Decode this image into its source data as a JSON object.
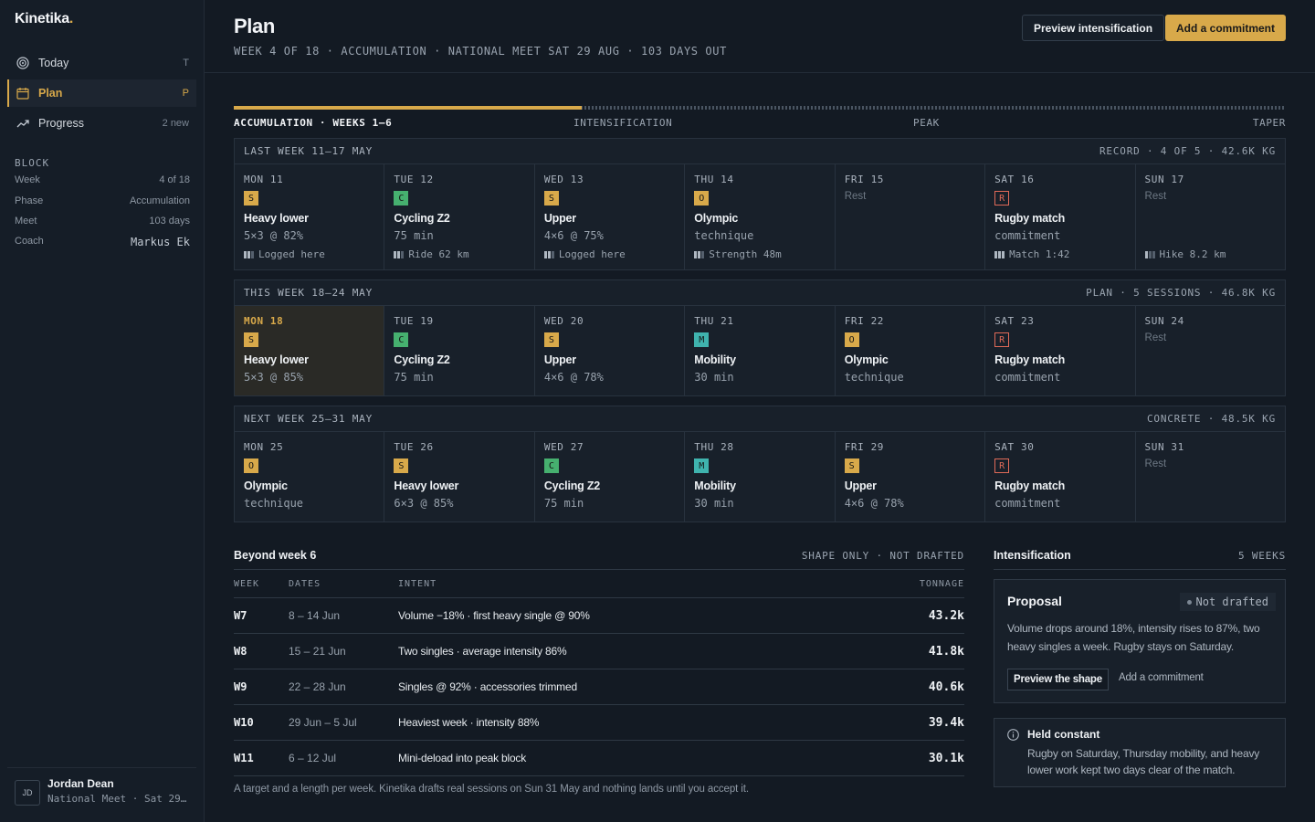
{
  "app": {
    "brand": "Kinetika",
    "brand_dot": "."
  },
  "nav": [
    {
      "label": "Today",
      "key": "T"
    },
    {
      "label": "Plan",
      "key": "P"
    },
    {
      "label": "Progress",
      "key": "2 new"
    }
  ],
  "block": {
    "title": "BLOCK",
    "rows": [
      {
        "k": "Week",
        "v": "4 of 18"
      },
      {
        "k": "Phase",
        "v": "Accumulation"
      },
      {
        "k": "Meet",
        "v": "103 days"
      },
      {
        "k": "Coach",
        "v": "Markus Ek"
      }
    ]
  },
  "user": {
    "initials": "JD",
    "name": "Jordan Dean",
    "subtitle": "National Meet · Sat 29 Aug"
  },
  "header": {
    "title": "Plan",
    "subtitle": "WEEK 4 OF 18 · ACCUMULATION · NATIONAL MEET SAT 29 AUG · 103 DAYS OUT",
    "preview_label": "Preview intensification",
    "add_label": "Add a commitment"
  },
  "phases": {
    "progress": 0.331,
    "labels": [
      "ACCUMULATION · WEEKS 1–6",
      "INTENSIFICATION",
      "PEAK",
      "TAPER"
    ]
  },
  "weeks": [
    {
      "label": "LAST WEEK  11–17 MAY",
      "meta": "RECORD · 4 OF 5 · 42.6K KG",
      "days": [
        {
          "label": "MON 11",
          "type": "S",
          "title": "Heavy lower",
          "detail": "5×3 @ 82%",
          "log": "Logged here",
          "bars": 2
        },
        {
          "label": "TUE 12",
          "type": "C",
          "title": "Cycling Z2",
          "detail": "75 min",
          "log": "Ride 62 km",
          "bars": 2
        },
        {
          "label": "WED 13",
          "type": "S",
          "title": "Upper",
          "detail": "4×6 @ 75%",
          "log": "Logged here",
          "bars": 2
        },
        {
          "label": "THU 14",
          "type": "O",
          "title": "Olympic",
          "detail": "technique",
          "log": "Strength 48m",
          "bars": 2
        },
        {
          "label": "FRI 15",
          "rest": "Rest"
        },
        {
          "label": "SAT 16",
          "type": "R",
          "title": "Rugby match",
          "detail": "commitment",
          "log": "Match 1:42",
          "bars": 3
        },
        {
          "label": "SUN 17",
          "rest": "Rest",
          "log": "Hike 8.2 km",
          "bars": 1
        }
      ]
    },
    {
      "label": "THIS WEEK  18–24 MAY",
      "meta": "PLAN · 5 SESSIONS · 46.8K KG",
      "days": [
        {
          "label": "MON 18",
          "type": "S",
          "title": "Heavy lower",
          "detail": "5×3 @ 85%",
          "today": true
        },
        {
          "label": "TUE 19",
          "type": "C",
          "title": "Cycling Z2",
          "detail": "75 min"
        },
        {
          "label": "WED 20",
          "type": "S",
          "title": "Upper",
          "detail": "4×6 @ 78%"
        },
        {
          "label": "THU 21",
          "type": "M",
          "title": "Mobility",
          "detail": "30 min"
        },
        {
          "label": "FRI 22",
          "type": "O",
          "title": "Olympic",
          "detail": "technique"
        },
        {
          "label": "SAT 23",
          "type": "R",
          "title": "Rugby match",
          "detail": "commitment"
        },
        {
          "label": "SUN 24",
          "rest": "Rest"
        }
      ]
    },
    {
      "label": "NEXT WEEK  25–31 MAY",
      "meta": "CONCRETE · 48.5K KG",
      "days": [
        {
          "label": "MON 25",
          "type": "O",
          "title": "Olympic",
          "detail": "technique"
        },
        {
          "label": "TUE 26",
          "type": "S",
          "title": "Heavy lower",
          "detail": "6×3 @ 85%"
        },
        {
          "label": "WED 27",
          "type": "C",
          "title": "Cycling Z2",
          "detail": "75 min"
        },
        {
          "label": "THU 28",
          "type": "M",
          "title": "Mobility",
          "detail": "30 min"
        },
        {
          "label": "FRI 29",
          "type": "S",
          "title": "Upper",
          "detail": "4×6 @ 78%"
        },
        {
          "label": "SAT 30",
          "type": "R",
          "title": "Rugby match",
          "detail": "commitment"
        },
        {
          "label": "SUN 31",
          "rest": "Rest"
        }
      ]
    }
  ],
  "beyond": {
    "title": "Beyond week 6",
    "tag": "SHAPE ONLY · NOT DRAFTED",
    "columns": {
      "week": "WEEK",
      "dates": "DATES",
      "intent": "INTENT",
      "tonnage": "TONNAGE"
    },
    "rows": [
      {
        "week": "W7",
        "dates": "8 – 14 Jun",
        "intent": "Volume −18% · first heavy single @ 90%",
        "tonnage": "43.2k"
      },
      {
        "week": "W8",
        "dates": "15 – 21 Jun",
        "intent": "Two singles · average intensity 86%",
        "tonnage": "41.8k"
      },
      {
        "week": "W9",
        "dates": "22 – 28 Jun",
        "intent": "Singles @ 92% · accessories trimmed",
        "tonnage": "40.6k"
      },
      {
        "week": "W10",
        "dates": "29 Jun – 5 Jul",
        "intent": "Heaviest week · intensity 88%",
        "tonnage": "39.4k"
      },
      {
        "week": "W11",
        "dates": "6 – 12 Jul",
        "intent": "Mini-deload into peak block",
        "tonnage": "30.1k"
      }
    ],
    "footnote": "A target and a length per week. Kinetika drafts real sessions on Sun 31 May and nothing lands until you accept it."
  },
  "intensification": {
    "title": "Intensification",
    "weeks": "5 WEEKS",
    "proposal": {
      "title": "Proposal",
      "state": "Not drafted",
      "body": "Volume drops around 18%, intensity rises to 87%, two heavy singles a week. Rugby stays on Saturday.",
      "preview": "Preview the shape",
      "add": "Add a commitment"
    },
    "held": {
      "title": "Held constant",
      "body": "Rugby on Saturday, Thursday mobility, and heavy lower work kept two days clear of the match."
    }
  },
  "colors": {
    "accent": "#d8a94a",
    "strength": "#d8a94a",
    "cardio": "#46b06f",
    "mobility": "#3fb3ae",
    "rugby": "#e06a58"
  }
}
